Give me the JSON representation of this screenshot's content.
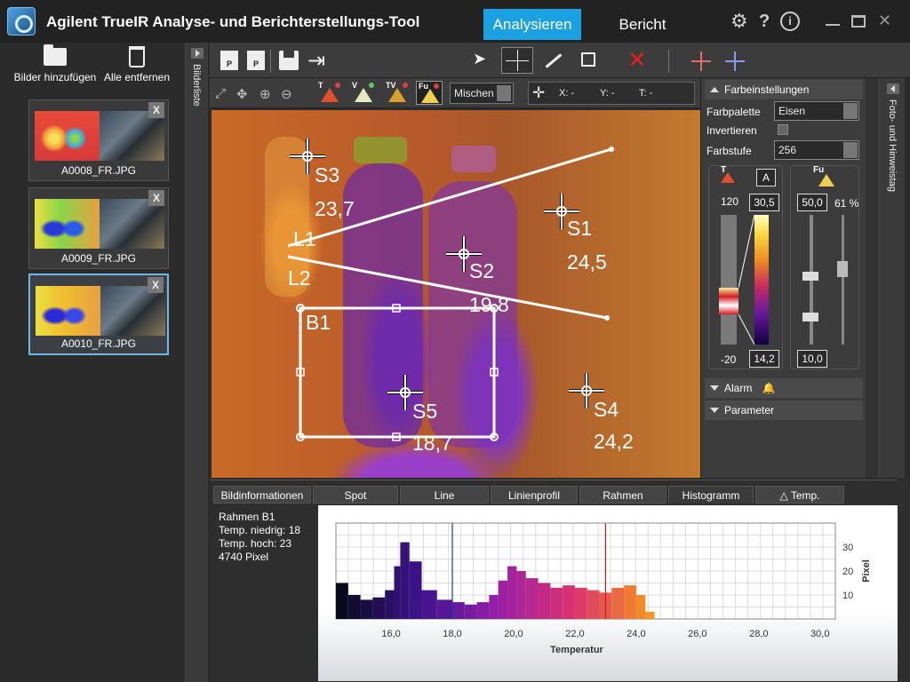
{
  "app": {
    "title": "Agilent TrueIR Analyse- und Berichterstellungs-Tool",
    "modes": [
      "Analysieren",
      "Bericht"
    ],
    "active_mode": "Analysieren",
    "icons": [
      "gear-icon",
      "help-icon",
      "info-icon",
      "minimize-icon",
      "maximize-icon",
      "close-icon"
    ]
  },
  "left_panel": {
    "add_label": "Bilder hinzufügen",
    "remove_label": "Alle entfernen",
    "thumbnails": [
      {
        "name": "A0008_FR.JPG",
        "remove": "X"
      },
      {
        "name": "A0009_FR.JPG",
        "remove": "X"
      },
      {
        "name": "A0010_FR.JPG",
        "remove": "X",
        "selected": true
      }
    ],
    "strip_label": "Bilderliste"
  },
  "right_strip_label": "Foto- und Hinweistag",
  "toolbar": {
    "file_badge_open": "P",
    "file_badge_save": "P",
    "palette_buttons": [
      {
        "label": "T"
      },
      {
        "label": "V"
      },
      {
        "label": "TV"
      },
      {
        "label": "Fu"
      }
    ],
    "blend_mode": "Mischen",
    "coords": {
      "x": "X: -",
      "y": "Y: -",
      "t": "T: -"
    }
  },
  "markers": {
    "spots": [
      {
        "label": "S1",
        "value": "24,5"
      },
      {
        "label": "S2",
        "value": "19,8"
      },
      {
        "label": "S3",
        "value": "23,7"
      },
      {
        "label": "S4",
        "value": "24,2"
      },
      {
        "label": "S5",
        "value": "18,7"
      }
    ],
    "lines": [
      "L1",
      "L2"
    ],
    "boxes": [
      "B1"
    ]
  },
  "color_settings": {
    "section_title": "Farbeinstellungen",
    "palette_label": "Farbpalette",
    "palette_value": "Eisen",
    "invert_label": "Invertieren",
    "levels_label": "Farbstufe",
    "levels_value": "256",
    "t_badge": "T",
    "a_button": "A",
    "fu_badge": "Fu",
    "scale_max": "120",
    "scale_min": "-20",
    "range_high": "30,5",
    "range_low": "14,2",
    "fu_high": "50,0",
    "fu_low": "10,0",
    "fu_percent": "61 %",
    "alarm_title": "Alarm",
    "param_title": "Parameter"
  },
  "bottom_tabs": {
    "items": [
      "Bildinformationen",
      "Spot",
      "Line",
      "Linienprofil",
      "Rahmen",
      "Histogramm",
      "Temp."
    ],
    "active": "Histogramm"
  },
  "info": {
    "lines": [
      "Rahmen B1",
      "Temp. niedrig: 18",
      "Temp. hoch: 23",
      "4740 Pixel"
    ]
  },
  "chart_data": {
    "type": "bar",
    "title": "",
    "xlabel": "Temperatur",
    "ylabel": "Pixel",
    "xlim": [
      14.2,
      30.5
    ],
    "ylim": [
      0,
      40
    ],
    "xticks": [
      "16,0",
      "18,0",
      "20,0",
      "22,0",
      "24,0",
      "26,0",
      "28,0",
      "30,0"
    ],
    "yticks": [
      "10",
      "20",
      "30"
    ],
    "markers": [
      {
        "x": 18.0,
        "color": "#1a3aa0"
      },
      {
        "x": 23.0,
        "color": "#d01a1a"
      }
    ],
    "x": [
      14.2,
      14.6,
      15.0,
      15.4,
      15.8,
      16.1,
      16.3,
      16.6,
      17.0,
      17.5,
      18.0,
      18.4,
      18.8,
      19.2,
      19.5,
      19.8,
      20.1,
      20.4,
      20.8,
      21.2,
      21.6,
      22.0,
      22.4,
      22.8,
      23.2,
      23.6,
      24.0,
      24.3
    ],
    "values": [
      15,
      10,
      8,
      9,
      12,
      22,
      32,
      24,
      12,
      8,
      7,
      6,
      7,
      10,
      16,
      22,
      20,
      17,
      15,
      13,
      14,
      13,
      12,
      11,
      13,
      14,
      10,
      3
    ]
  }
}
